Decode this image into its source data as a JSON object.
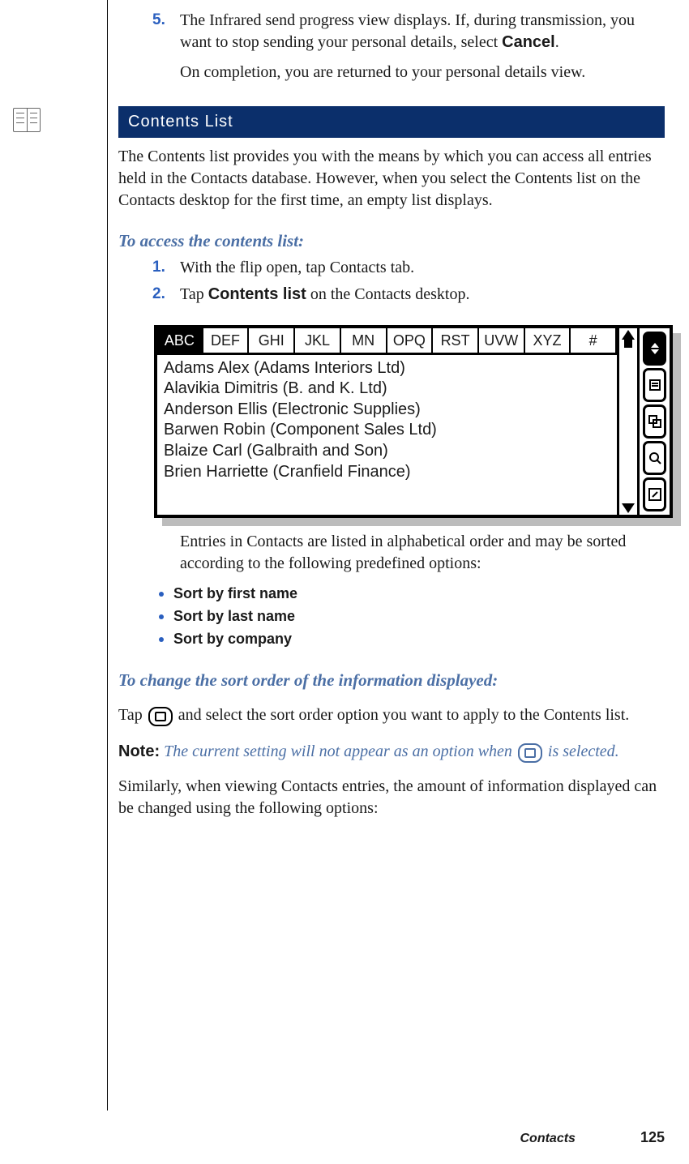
{
  "step5": {
    "num": "5.",
    "para1_a": "The Infrared send progress view displays. If, during transmission, you want to stop sending your personal details, select ",
    "para1_bold": "Cancel",
    "para1_b": ".",
    "para2": "On completion, you are returned to your personal details view."
  },
  "heading": "Contents List",
  "intro": "The Contents list provides you with the means by which you can access all entries held in the Contacts database. However, when you select the Contents list on the Contacts desktop for the first time, an empty list displays.",
  "sub1": "To access the contents list:",
  "s1": {
    "num": "1.",
    "txt": "With the flip open, tap Contacts tab."
  },
  "s2": {
    "num": "2.",
    "a": "Tap ",
    "bold": "Contents list",
    "b": " on the Contacts desktop."
  },
  "screen": {
    "tabs": [
      "ABC",
      "DEF",
      "GHI",
      "JKL",
      "MN",
      "OPQ",
      "RST",
      "UVW",
      "XYZ",
      "#"
    ],
    "active_tab": 0,
    "rows": [
      "Adams  Alex (Adams Interiors Ltd)",
      "Alavikia Dimitris (B. and K. Ltd)",
      "Anderson Ellis (Electronic Supplies)",
      "Barwen Robin (Component Sales Ltd)",
      "Blaize Carl (Galbraith and Son)",
      "Brien Harriette (Cranfield Finance)"
    ]
  },
  "after_screen": "Entries in Contacts are listed in alphabetical order and may be sorted according to the following predefined options:",
  "bullets": [
    "Sort by first name",
    "Sort by last name",
    "Sort by company"
  ],
  "sub2": "To change the sort order of the information displayed:",
  "sort_para_a": "Tap ",
  "sort_para_b": " and select the sort order option you want to apply to the Contents list.",
  "note_label": "Note:",
  "note_a": "The current setting will not appear as an option when ",
  "note_b": " is selected.",
  "tail": "Similarly, when viewing Contacts entries, the amount of information displayed can be changed using the following options:",
  "footer": {
    "section": "Contacts",
    "page": "125"
  }
}
